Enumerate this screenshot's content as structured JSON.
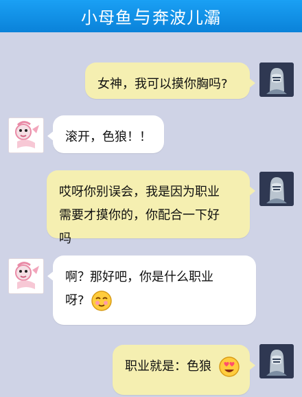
{
  "title_bar": {
    "left_name": "小母鱼",
    "joiner": "与",
    "right_name": "奔波儿灞"
  },
  "messages": [
    {
      "side": "right",
      "lines": [
        "女神，我可以摸你胸吗?"
      ]
    },
    {
      "side": "left",
      "lines": [
        "滚开，色狼！！"
      ]
    },
    {
      "side": "right",
      "lines": [
        "哎呀你别误会，我是因为职业",
        "需要才摸你的，你配合一下好",
        "吗"
      ]
    },
    {
      "side": "left",
      "lines": [
        "啊？那好吧，你是什么职业",
        "呀?"
      ],
      "emoji": "blush-face-icon"
    },
    {
      "side": "right",
      "lines": [
        "职业就是：色狼"
      ],
      "emoji": "heart-eyes-icon"
    }
  ],
  "colors": {
    "background": "#cfd3e6",
    "header": "#0a82d9",
    "mine_bubble": "#f5efb1",
    "theirs_bubble": "#ffffff"
  }
}
